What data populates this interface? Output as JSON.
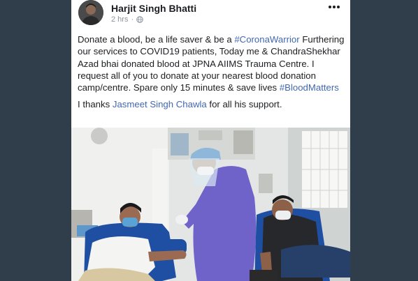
{
  "post": {
    "author": "Harjit Singh Bhatti",
    "timestamp": "2 hrs",
    "text_line1_a": "Donate a blood, be a life saver & be a ",
    "hashtag_corona": "#CoronaWarrior",
    "text_body": "Furthering our services to COVID19 patients, Today me & ChandraShekhar Azad bhai donated blood at JPNA AIIMS Trauma Centre. I request all of you to donate at your nearest blood donation camp/centre. Spare only 15 minutes & save lives ",
    "hashtag_blood": "#BloodMatters",
    "thanks_prefix": "I thanks ",
    "mention": "Jasmeet Singh Chawla",
    "thanks_suffix": " for all his support."
  },
  "icons": {
    "more": "more-options-icon",
    "privacy": "globe-icon"
  },
  "colors": {
    "background": "#2f3e4a",
    "link": "#4267b2",
    "text": "#1c1e21",
    "meta": "#8d949e"
  }
}
